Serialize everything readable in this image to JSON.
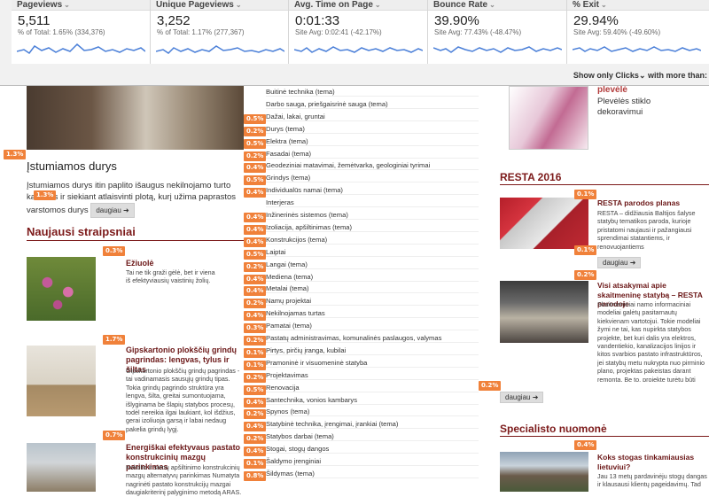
{
  "metrics": [
    {
      "label": "Pageviews",
      "value": "5,511",
      "sub": "% of Total: 1.65% (334,376)"
    },
    {
      "label": "Unique Pageviews",
      "value": "3,252",
      "sub": "% of Total: 1.17% (277,367)"
    },
    {
      "label": "Avg. Time on Page",
      "value": "0:01:33",
      "sub": "Site Avg: 0:02:41 (-42.17%)"
    },
    {
      "label": "Bounce Rate",
      "value": "39.90%",
      "sub": "Site Avg: 77.43% (-48.47%)"
    },
    {
      "label": "% Exit",
      "value": "29.94%",
      "sub": "Site Avg: 59.40% (-49.60%)"
    }
  ],
  "filter": {
    "show_only": "Show only",
    "clicks": "Clicks",
    "with_more": "with more than:"
  },
  "left": {
    "door_title": "Įstumiamos durys",
    "door_text": "Įstumiamos durys itin paplito išaugus nekilnojamo turto kainoms ir siekiant atlaisvinti plotą, kurį užima paprastos varstomos durys",
    "more": "daugiau",
    "naujausi": "Naujausi straipsniai",
    "articles": [
      {
        "title": "Ežiuolė",
        "desc": "Tai ne tik graži gėlė, bet ir viena iš efektyviausių vaistinių žolių.",
        "badge": "0.3%"
      },
      {
        "title": "Gipskartonio plokščių grindų pagrindas: lengvas, tylus ir šiltas",
        "desc": "Gipskartonio plokščių grindų pagrindas - tai vadinamasis sausųjų grindų tipas. Tokia grindų pagrindo struktūra yra lengva, šilta, greitai sumontuojama, išlyginama be šlapių statybos procesų, todėl nereikia ilgai laukiant, kol išdžius, gerai izoliuoja garsą ir labai nedaug pakelia grindų lygį.",
        "badge": "1.7%"
      },
      {
        "title": "Energiškai efektyvaus pastato konstrukcinių mazgų parinkimas",
        "desc": "Kokolio ir sienų apšiltinimo konstrukcinių mazgų alternatyvų parinkimas Numatyta nagrinėti pastato konstrukcijų mazgai daugiakriterinį palyginimo metodą ARAS.",
        "badge": "0.7%"
      }
    ],
    "badges": {
      "door_left": "1.3%",
      "door_text": "1.3%"
    }
  },
  "categories": [
    {
      "label": "Buitinė technika (tema)",
      "badge": ""
    },
    {
      "label": "Darbo sauga, priešgaisrinė sauga (tema)",
      "badge": ""
    },
    {
      "label": "Dažai, lakai, gruntai",
      "badge": "0.5%"
    },
    {
      "label": "Durys (tema)",
      "badge": "0.2%"
    },
    {
      "label": "Elektra (tema)",
      "badge": "0.5%"
    },
    {
      "label": "Fasadai (tema)",
      "badge": "0.2%"
    },
    {
      "label": "Geodeziniai matavimai, žemėtvarka, geologiniai tyrimai",
      "badge": "0.4%"
    },
    {
      "label": "Grindys (tema)",
      "badge": "0.5%"
    },
    {
      "label": "Individualūs namai (tema)",
      "badge": "0.4%"
    },
    {
      "label": "Interjeras",
      "badge": ""
    },
    {
      "label": "Inžinerinės sistemos (tema)",
      "badge": "0.4%"
    },
    {
      "label": "Izoliacija, apšiltinimas (tema)",
      "badge": "0.4%"
    },
    {
      "label": "Konstrukcijos (tema)",
      "badge": "0.4%"
    },
    {
      "label": "Laiptai",
      "badge": "0.5%"
    },
    {
      "label": "Langai (tema)",
      "badge": "0.2%"
    },
    {
      "label": "Mediena (tema)",
      "badge": "0.4%"
    },
    {
      "label": "Metalai (tema)",
      "badge": "0.4%"
    },
    {
      "label": "Namų projektai",
      "badge": "0.2%"
    },
    {
      "label": "Nekilnojamas turtas",
      "badge": "0.4%"
    },
    {
      "label": "Pamatai (tema)",
      "badge": "0.3%"
    },
    {
      "label": "Pastatų administravimas, komunalinės paslaugos, valymas",
      "badge": "0.2%"
    },
    {
      "label": "Pirtys, pirčių įranga, kubilai",
      "badge": "0.1%"
    },
    {
      "label": "Pramoninė ir visuomeninė statyba",
      "badge": "0.1%"
    },
    {
      "label": "Projektavimas",
      "badge": "0.2%"
    },
    {
      "label": "Renovacija",
      "badge": "0.5%"
    },
    {
      "label": "Santechnika, vonios kambarys",
      "badge": "0.4%"
    },
    {
      "label": "Spynos (tema)",
      "badge": "0.2%"
    },
    {
      "label": "Statybinė technika, įrengimai, įrankiai (tema)",
      "badge": "0.4%"
    },
    {
      "label": "Statybos darbai (tema)",
      "badge": "0.2%"
    },
    {
      "label": "Stogai, stogų dangos",
      "badge": "0.4%"
    },
    {
      "label": "Šaldymo įrenginiai",
      "badge": "0.1%"
    },
    {
      "label": "Šildymas (tema)",
      "badge": "0.8%"
    }
  ],
  "right": {
    "top_title": "plevėlė",
    "top_desc": "Plevėlės stiklo dekoravimui",
    "resta_heading": "RESTA 2016",
    "resta_articles": [
      {
        "title": "RESTA parodos planas",
        "desc": "RESTA – didžiausia Baltijos šalyse statybų tematikos paroda, kurioje pristatomi naujausi ir pažangiausi sprendimai statantiems, ir renovuojantiems",
        "badge": "0.1%",
        "badge2": "0.1%",
        "more": "daugiau"
      },
      {
        "title": "Visi atsakymai apie skaitmeninę statybą – RESTA parodoje",
        "desc": "Skaitmeniniai namo informaciniai modeliai galėtų pasitarnautų kiekvienam vartotojui. Tokie modeliai žymi ne tai, kas nupirkta statybos projekte, bet kuri dalis yra elektros, vandentiekio, kanalizacijos linijos ir kitos svarbios pastato infrastruktūros, jei statybų metu nukrypta nuo pirminio plano, projektas pakeistas darant remontą. Be to, projekte turėtų būti nurodytos visos medžiagos, panaudotos statybai. Pavyzdžiui, kad buto gyventojas žinotų, kuri siena karkasinė, o kuri mūrinė.",
        "badge": "0.2%",
        "badge2": "0.2%",
        "more": "daugiau"
      }
    ],
    "specialist_heading": "Specialisto nuomonė",
    "specialist_badge": "0.4%",
    "specialist_article": {
      "title": "Koks stogas tinkamiausias lietuviui?",
      "desc": "Jau 13 metų pardavinėju stogų dangas ir klausausi klientų pageidavimų. Tad",
      "badge": "0.4%"
    }
  },
  "colors": {
    "accent": "#7c1a1a",
    "badge": "#f0813a",
    "spark": "#4a7fd8"
  }
}
